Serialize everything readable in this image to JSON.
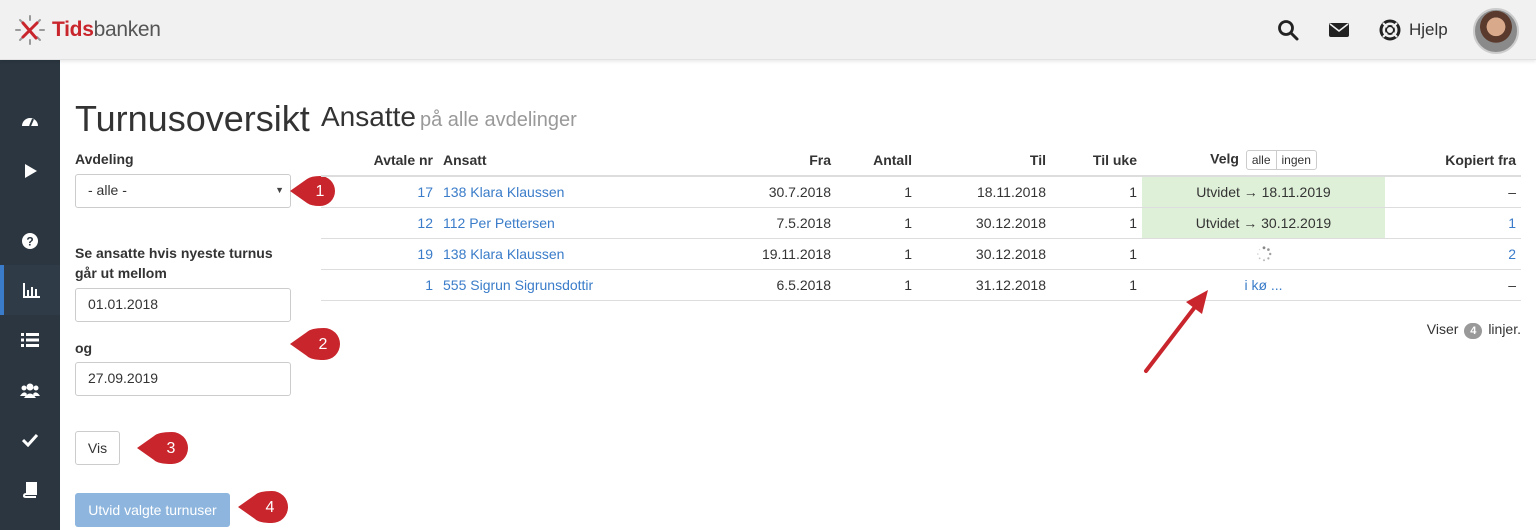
{
  "brand": {
    "name_bold": "Tids",
    "name_rest": "banken"
  },
  "header": {
    "help_label": "Hjelp"
  },
  "sidebar": {
    "items": [
      "dashboard-icon",
      "play-icon",
      "question-icon",
      "bar-chart-icon",
      "list-icon",
      "users-icon",
      "check-icon",
      "book-icon"
    ],
    "active": "bar-chart-icon"
  },
  "left": {
    "title": "Turnusoversikt",
    "department_label": "Avdeling",
    "department_value": "- alle -",
    "range_label": "Se ansatte hvis nyeste turnus går ut mellom",
    "date_from": "01.01.2018",
    "and_label": "og",
    "date_to": "27.09.2019",
    "show_button": "Vis",
    "extend_button": "Utvid valgte turnuser"
  },
  "main": {
    "title": "Ansatte",
    "subtitle": "på alle avdelinger",
    "columns": {
      "avtale_nr": "Avtale nr",
      "ansatt": "Ansatt",
      "fra": "Fra",
      "antall": "Antall",
      "til": "Til",
      "til_uke": "Til uke",
      "velg": "Velg",
      "velg_all": "alle",
      "velg_none": "ingen",
      "kopiert_fra": "Kopiert fra"
    },
    "rows": [
      {
        "avtale_nr": "17",
        "ansatt": "138 Klara Klaussen",
        "fra": "30.7.2018",
        "antall": "1",
        "til": "18.11.2018",
        "til_uke": "1",
        "velg": "Utvidet → 18.11.2019",
        "velg_state": "extended",
        "kopiert_fra": "–"
      },
      {
        "avtale_nr": "12",
        "ansatt": "112 Per Pettersen",
        "fra": "7.5.2018",
        "antall": "1",
        "til": "30.12.2018",
        "til_uke": "1",
        "velg": "Utvidet → 30.12.2019",
        "velg_state": "extended",
        "kopiert_fra": "1"
      },
      {
        "avtale_nr": "19",
        "ansatt": "138 Klara Klaussen",
        "fra": "19.11.2018",
        "antall": "1",
        "til": "30.12.2018",
        "til_uke": "1",
        "velg": "",
        "velg_state": "loading",
        "kopiert_fra": "2"
      },
      {
        "avtale_nr": "1",
        "ansatt": "555 Sigrun Sigrunsdottir",
        "fra": "6.5.2018",
        "antall": "1",
        "til": "31.12.2018",
        "til_uke": "1",
        "velg": "i kø ...",
        "velg_state": "queued",
        "kopiert_fra": "–"
      }
    ],
    "footer_prefix": "Viser",
    "footer_count": "4",
    "footer_suffix": "linjer."
  },
  "annotations": [
    "1",
    "2",
    "3",
    "4"
  ],
  "colors": {
    "accent_red": "#c9252c",
    "link_blue": "#3a7cc9",
    "sidebar_bg": "#2b3640",
    "extended_bg": "#dff0d8",
    "primary_disabled": "#8db5de"
  }
}
